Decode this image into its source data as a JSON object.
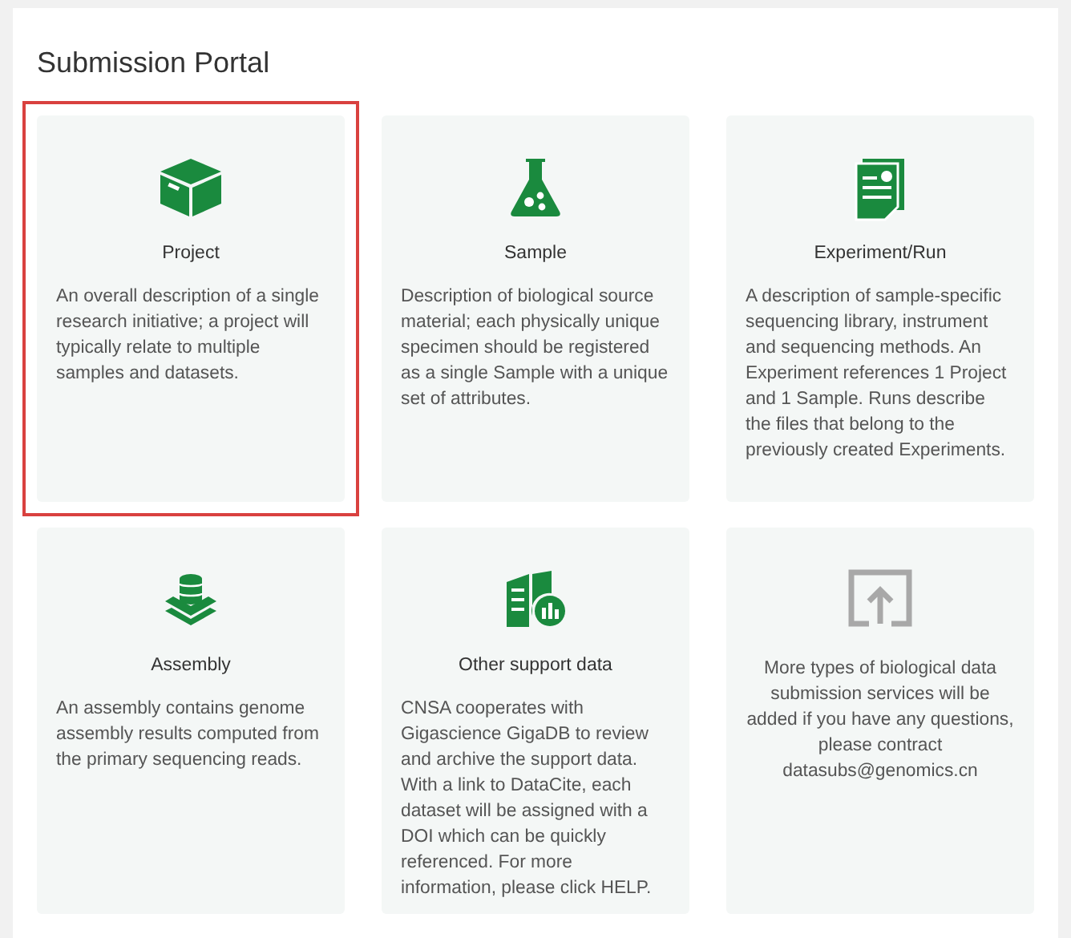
{
  "title": "Submission Portal",
  "cards": [
    {
      "kind": "service",
      "title": "Project",
      "description": "An overall description of a single research initiative; a project will typically relate to multiple samples and datasets.",
      "selected": true
    },
    {
      "kind": "service",
      "title": "Sample",
      "description": "Description of biological source material; each physically unique specimen should be registered as a single Sample with a unique set of attributes.",
      "selected": false
    },
    {
      "kind": "service",
      "title": "Experiment/Run",
      "description": "A description of sample-specific sequencing library, instrument and sequencing methods. An Experiment references 1 Project and 1 Sample. Runs describe the files that belong to the previously created Experiments.",
      "selected": false
    },
    {
      "kind": "service",
      "title": "Assembly",
      "description": "An assembly contains genome assembly results computed from the primary sequencing reads.",
      "selected": false
    },
    {
      "kind": "service",
      "title": "Other support data",
      "description": "CNSA cooperates with Gigascience GigaDB to review and archive the support data. With a link to DataCite, each dataset will be assigned with a DOI which can be quickly referenced. For more information, please click HELP.",
      "selected": false
    },
    {
      "kind": "notice",
      "description": "More types of biological data submission services will be added if you have any questions, please contract datasubs@genomics.cn",
      "selected": false
    }
  ]
}
